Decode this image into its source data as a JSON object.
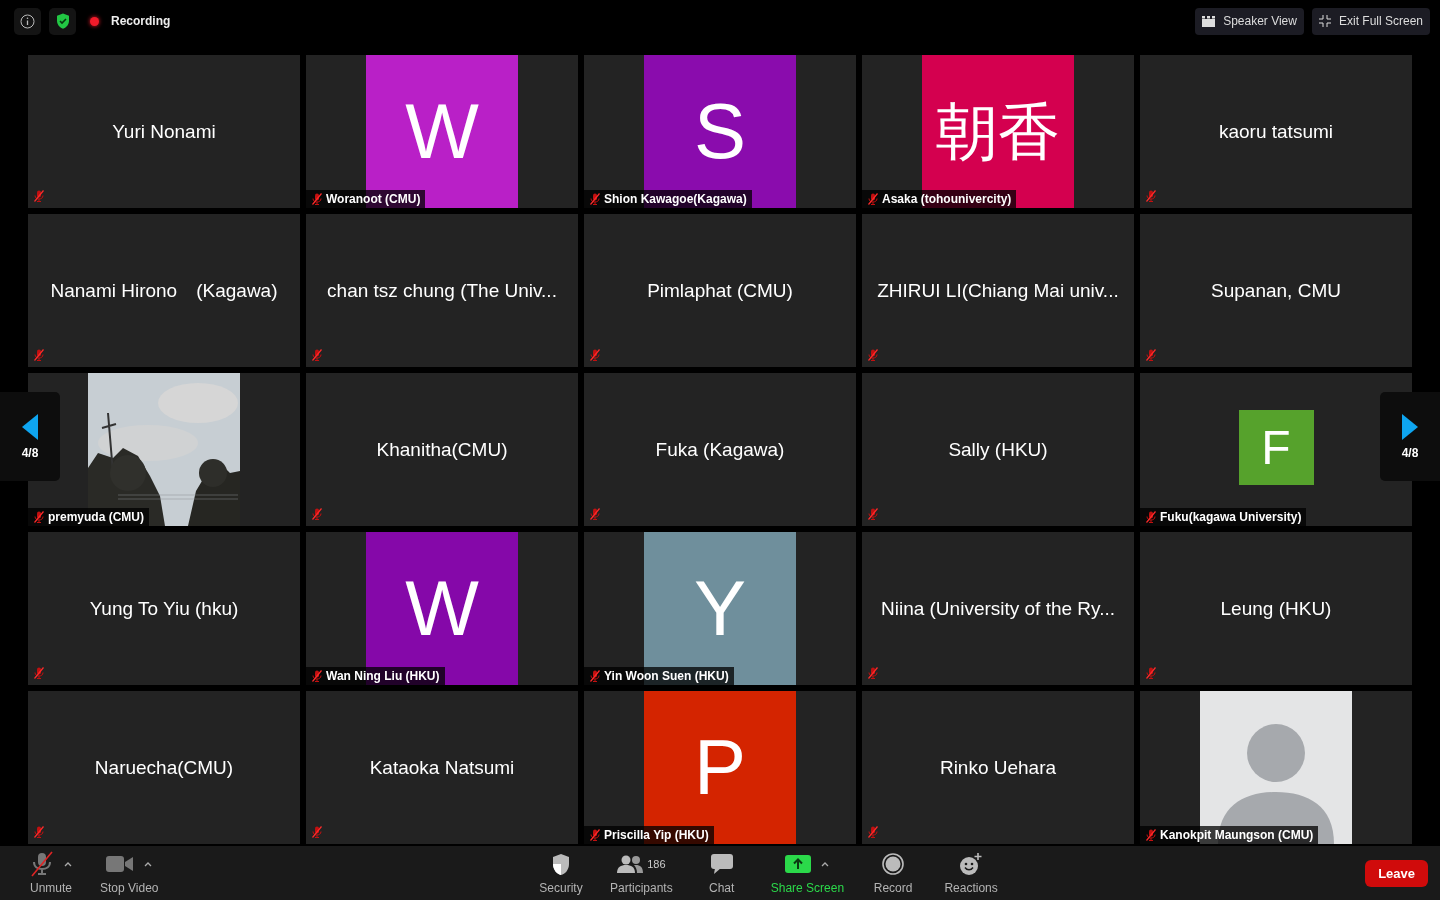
{
  "top_bar": {
    "recording_label": "Recording",
    "buttons": [
      {
        "label": "Speaker View",
        "kind": "speaker"
      },
      {
        "label": "Exit Full Screen",
        "kind": "exit"
      }
    ]
  },
  "pager": {
    "left": "4/8",
    "right": "4/8"
  },
  "tiles": [
    {
      "kind": "name",
      "name": "Yuri Nonami",
      "muted": true
    },
    {
      "kind": "letter",
      "letter": "W",
      "color": "#b920c7",
      "name": "Woranoot (CMU)",
      "muted": true
    },
    {
      "kind": "letter",
      "letter": "S",
      "color": "#8a0cad",
      "name": "Shion Kawagoe(Kagawa)",
      "muted": true
    },
    {
      "kind": "letter",
      "letter": "朝香",
      "color": "#d4004f",
      "name": "Asaka (tohounivercity)",
      "muted": true
    },
    {
      "kind": "name",
      "name": "kaoru tatsumi",
      "muted": true
    },
    {
      "kind": "name",
      "name": "Nanami Hirono　(Kagawa)",
      "muted": true
    },
    {
      "kind": "name",
      "name": "chan tsz chung (The Univ...",
      "muted": true
    },
    {
      "kind": "name",
      "name": "Pimlaphat (CMU)",
      "muted": true
    },
    {
      "kind": "name",
      "name": "ZHIRUI LI(Chiang Mai univ...",
      "muted": true
    },
    {
      "kind": "name",
      "name": "Supanan, CMU",
      "muted": true
    },
    {
      "name": "premyuda (CMU)",
      "muted": true
    },
    {
      "kind": "name",
      "name": "Khanitha(CMU)",
      "muted": true
    },
    {
      "kind": "name",
      "name": "Fuka (Kagawa)",
      "muted": true
    },
    {
      "kind": "name",
      "name": "Sally (HKU)",
      "muted": true
    },
    {
      "kind": "letter-small",
      "letter": "F",
      "color": "#56a22c",
      "name": "Fuku(kagawa University)",
      "muted": true
    },
    {
      "kind": "name",
      "name": "Yung To Yiu (hku)",
      "muted": true
    },
    {
      "kind": "letter",
      "letter": "W",
      "color": "#8508a9",
      "name": "Wan Ning Liu (HKU)",
      "muted": true
    },
    {
      "kind": "letter",
      "letter": "Y",
      "color": "#6f8f9c",
      "name": "Yin Woon Suen (HKU)",
      "muted": true
    },
    {
      "kind": "name",
      "name": "Niina (University of the Ry...",
      "muted": true
    },
    {
      "kind": "name",
      "name": "Leung (HKU)",
      "muted": true
    },
    {
      "kind": "name",
      "name": "Naruecha(CMU)",
      "muted": true
    },
    {
      "kind": "name",
      "name": "Kataoka Natsumi",
      "muted": true
    },
    {
      "kind": "letter",
      "letter": "P",
      "color": "#d42400",
      "name": "Priscilla Yip (HKU)",
      "muted": true
    },
    {
      "kind": "name",
      "name": "Rinko Uehara",
      "muted": true
    },
    {
      "kind": "silhouette",
      "name": "Kanokpit Maungson (CMU)",
      "muted": true
    }
  ],
  "toolbar": {
    "left": [
      {
        "kind": "mic",
        "label": "Unmute",
        "caret": true
      },
      {
        "kind": "video",
        "label": "Stop Video",
        "caret": true
      }
    ],
    "center": [
      {
        "kind": "security",
        "label": "Security"
      },
      {
        "kind": "participants",
        "label": "Participants",
        "count": "186"
      },
      {
        "kind": "chat",
        "label": "Chat"
      },
      {
        "kind": "share",
        "label": "Share Screen",
        "caret": true
      },
      {
        "kind": "record",
        "label": "Record"
      },
      {
        "kind": "reactions",
        "label": "Reactions"
      }
    ],
    "leave": "Leave"
  }
}
